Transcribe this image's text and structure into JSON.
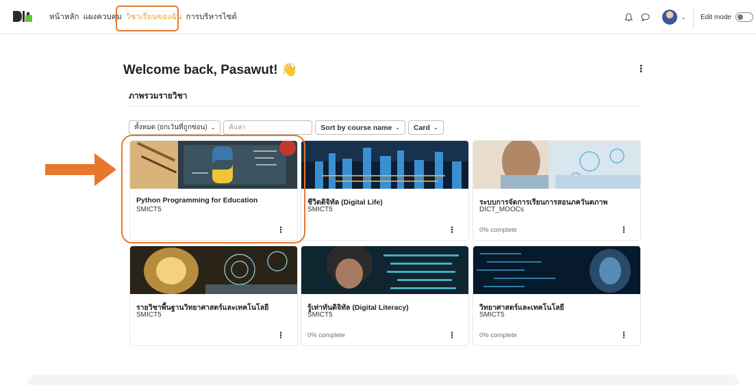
{
  "nav": {
    "logo_text": "DICT",
    "items": [
      {
        "label": "หน้าหลัก",
        "active": false
      },
      {
        "label": "แผงควบคุม",
        "active": false
      },
      {
        "label": "วิชาเรียนของฉัน",
        "active": true
      },
      {
        "label": "การบริหารไซต์",
        "active": false
      }
    ],
    "edit_mode_label": "Edit mode",
    "icons": [
      "bell-icon",
      "chat-icon",
      "user-avatar",
      "chevron-down-icon"
    ]
  },
  "page": {
    "welcome": "Welcome back, Pasawut! 👋",
    "section_title": "ภาพรวมรายวิชา"
  },
  "filters": {
    "grouping": "ทั้งหมด (ยกเว้นที่ถูกซ่อน)",
    "search_placeholder": "ค้นหา",
    "sort": "Sort by course name",
    "view": "Card"
  },
  "courses": [
    {
      "title": "Python Programming for Education",
      "category": "SMICT5",
      "progress": ""
    },
    {
      "title": "ชีวิตดิจิทัล (Digital Life)",
      "category": "SMICT5",
      "progress": ""
    },
    {
      "title": "ระบบการจัดการเรียนการสอนภควันตภาพ",
      "category": "DICT_MOOCs",
      "progress": "0% complete"
    },
    {
      "title": "รายวิชาพื้นฐานวิทยาศาสตร์และเทคโนโลยี",
      "category": "SMICT5",
      "progress": ""
    },
    {
      "title": "รู้เท่าทันดิจิทัล (Digital Literacy)",
      "category": "SMICT5",
      "progress": "0% complete"
    },
    {
      "title": "วิทยาศาสตร์และเทคโนโลยี",
      "category": "SMICT5",
      "progress": "0% complete"
    }
  ],
  "colors": {
    "accent": "#e8a23a",
    "annotation": "#e8772e"
  }
}
